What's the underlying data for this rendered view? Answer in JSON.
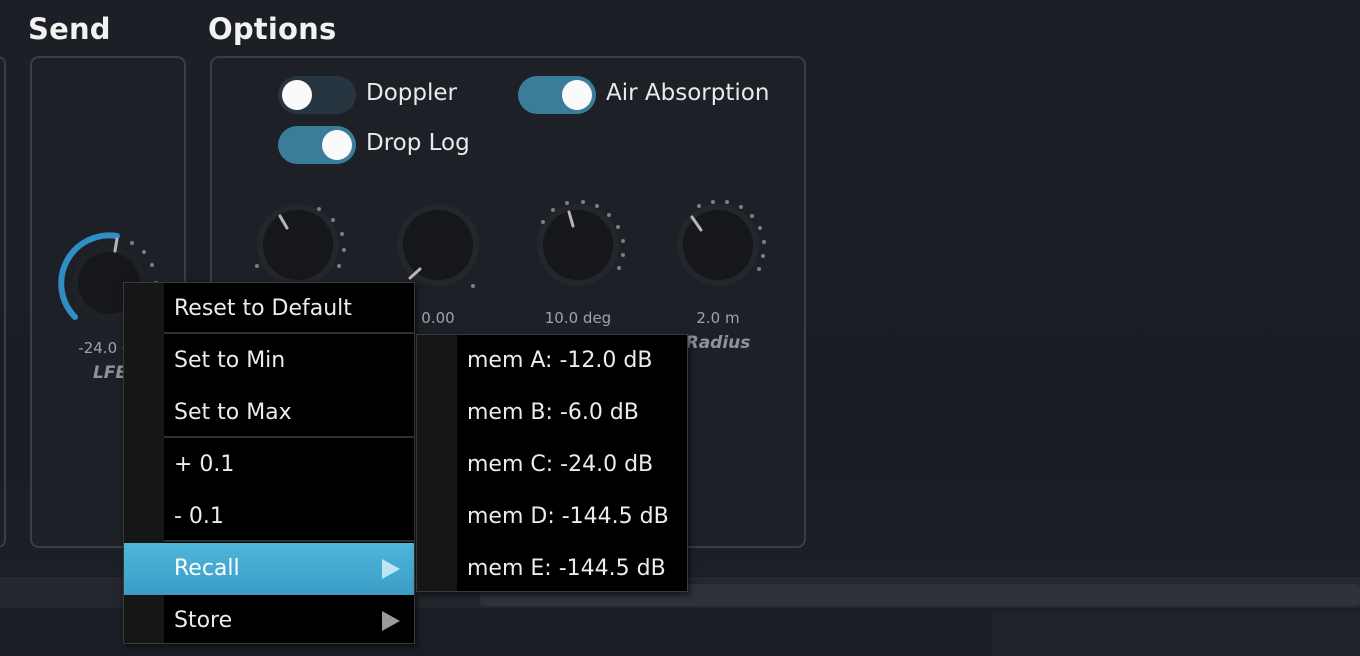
{
  "sections": {
    "send_title": "Send",
    "options_title": "Options"
  },
  "send": {
    "lfe_value": "-24.0 dB",
    "lfe_label": "LFE"
  },
  "options": {
    "toggles": [
      {
        "label": "Doppler",
        "state": "off"
      },
      {
        "label": "Air Absorption",
        "state": "on"
      },
      {
        "label": "Drop Log",
        "state": "on"
      }
    ],
    "knobs": [
      {
        "value": "",
        "label": ""
      },
      {
        "value": "0.00",
        "label": ""
      },
      {
        "value": "10.0 deg",
        "label": ""
      },
      {
        "value": "2.0 m",
        "label": "Radius"
      }
    ]
  },
  "context_menu": {
    "items": [
      {
        "label": "Reset to Default"
      },
      {
        "label": "Set to Min"
      },
      {
        "label": "Set to Max"
      },
      {
        "label": "+ 0.1"
      },
      {
        "label": "- 0.1"
      },
      {
        "label": "Recall",
        "submenu": true,
        "highlighted": true
      },
      {
        "label": "Store",
        "submenu": true
      }
    ],
    "recall_submenu": [
      {
        "label": "mem A: -12.0 dB"
      },
      {
        "label": "mem B: -6.0 dB"
      },
      {
        "label": "mem C: -24.0 dB"
      },
      {
        "label": "mem D: -144.5 dB"
      },
      {
        "label": "mem E: -144.5 dB"
      }
    ]
  },
  "colors": {
    "accent": "#3a9cc6",
    "toggle_on": "#3a7d98",
    "toggle_off": "#263540",
    "knob_arc": "#2f8fc4"
  }
}
